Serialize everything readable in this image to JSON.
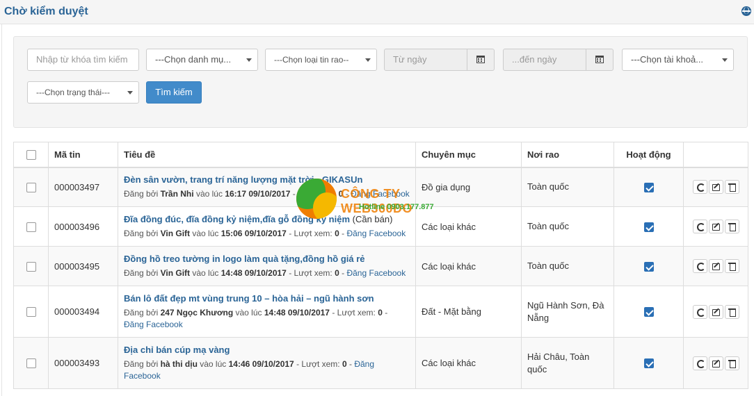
{
  "header": {
    "title": "Chờ kiểm duyệt"
  },
  "filters": {
    "keyword_placeholder": "Nhập từ khóa tìm kiếm",
    "category": "---Chọn danh mụ...",
    "listing_type": "---Chọn loại tin rao--",
    "from_date_placeholder": "Từ ngày",
    "to_date_placeholder": "...đến ngày",
    "account": "---Chọn tài khoả...",
    "status": "---Chọn trạng thái---",
    "search_label": "Tìm kiếm"
  },
  "table": {
    "columns": [
      "Mã tin",
      "Tiêu đề",
      "Chuyên mục",
      "Nơi rao",
      "Hoạt động"
    ],
    "meta_labels": {
      "posted_by": "Đăng bởi",
      "at": "vào lúc",
      "views": "- Lượt xem:",
      "facebook": "Đăng Facebook"
    },
    "rows": [
      {
        "id": "000003497",
        "title": "Đèn sân vườn, trang trí năng lượng mặt trời - GIKASUn",
        "title_tail": "",
        "author": "Trần Nhi",
        "time": "16:17 09/10/2017",
        "views": "0",
        "category": "Đồ gia dụng",
        "location": "Toàn quốc",
        "active": true
      },
      {
        "id": "000003496",
        "title": "Đĩa đồng đúc, đĩa đồng kỷ niệm,đĩa gỗ đồng kỷ niệm",
        "title_tail": " (Cần bán)",
        "author": "Vin Gift",
        "time": "15:06 09/10/2017",
        "views": "0",
        "category": "Các loại khác",
        "location": "Toàn quốc",
        "active": true
      },
      {
        "id": "000003495",
        "title": "Đồng hồ treo tường in logo làm quà tặng,đồng hồ giá rẻ",
        "title_tail": "",
        "author": "Vin Gift",
        "time": "14:48 09/10/2017",
        "views": "0",
        "category": "Các loại khác",
        "location": "Toàn quốc",
        "active": true
      },
      {
        "id": "000003494",
        "title": "Bán lô đất đẹp mt vùng trung 10 – hòa hải – ngũ hành sơn",
        "title_tail": "",
        "author": "247 Ngọc Khương",
        "time": "14:48 09/10/2017",
        "views": "0",
        "category": "Đất - Mặt bằng",
        "location": "Ngũ Hành Sơn, Đà Nẵng",
        "active": true
      },
      {
        "id": "000003493",
        "title": "Địa chỉ bán cúp mạ vàng",
        "title_tail": "",
        "author": "hà thi dịu",
        "time": "14:46 09/10/2017",
        "views": "0",
        "category": "Các loại khác",
        "location": "Hải Châu, Toàn quốc",
        "active": true
      }
    ]
  },
  "watermark": {
    "name": "CÔNG TY WEB360ĐO",
    "hotline": "Hotline 0903.177.877"
  },
  "colors": {
    "primary": "#428bca",
    "title_link": "#2a6496",
    "check": "#2a6fb5"
  }
}
